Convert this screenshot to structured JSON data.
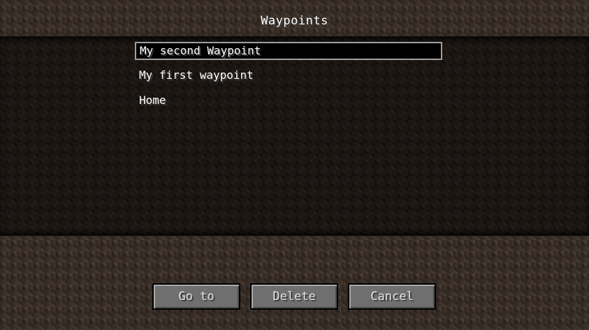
{
  "header": {
    "title": "Waypoints"
  },
  "waypoints": [
    {
      "label": "My second Waypoint",
      "selected": true
    },
    {
      "label": "My first waypoint",
      "selected": false
    },
    {
      "label": "Home",
      "selected": false
    }
  ],
  "buttons": {
    "go_to": "Go to",
    "delete": "Delete",
    "cancel": "Cancel"
  },
  "colors": {
    "text": "#ffffff",
    "button_bg": "#6f6f6f",
    "selection_border": "#a0a0a0"
  }
}
